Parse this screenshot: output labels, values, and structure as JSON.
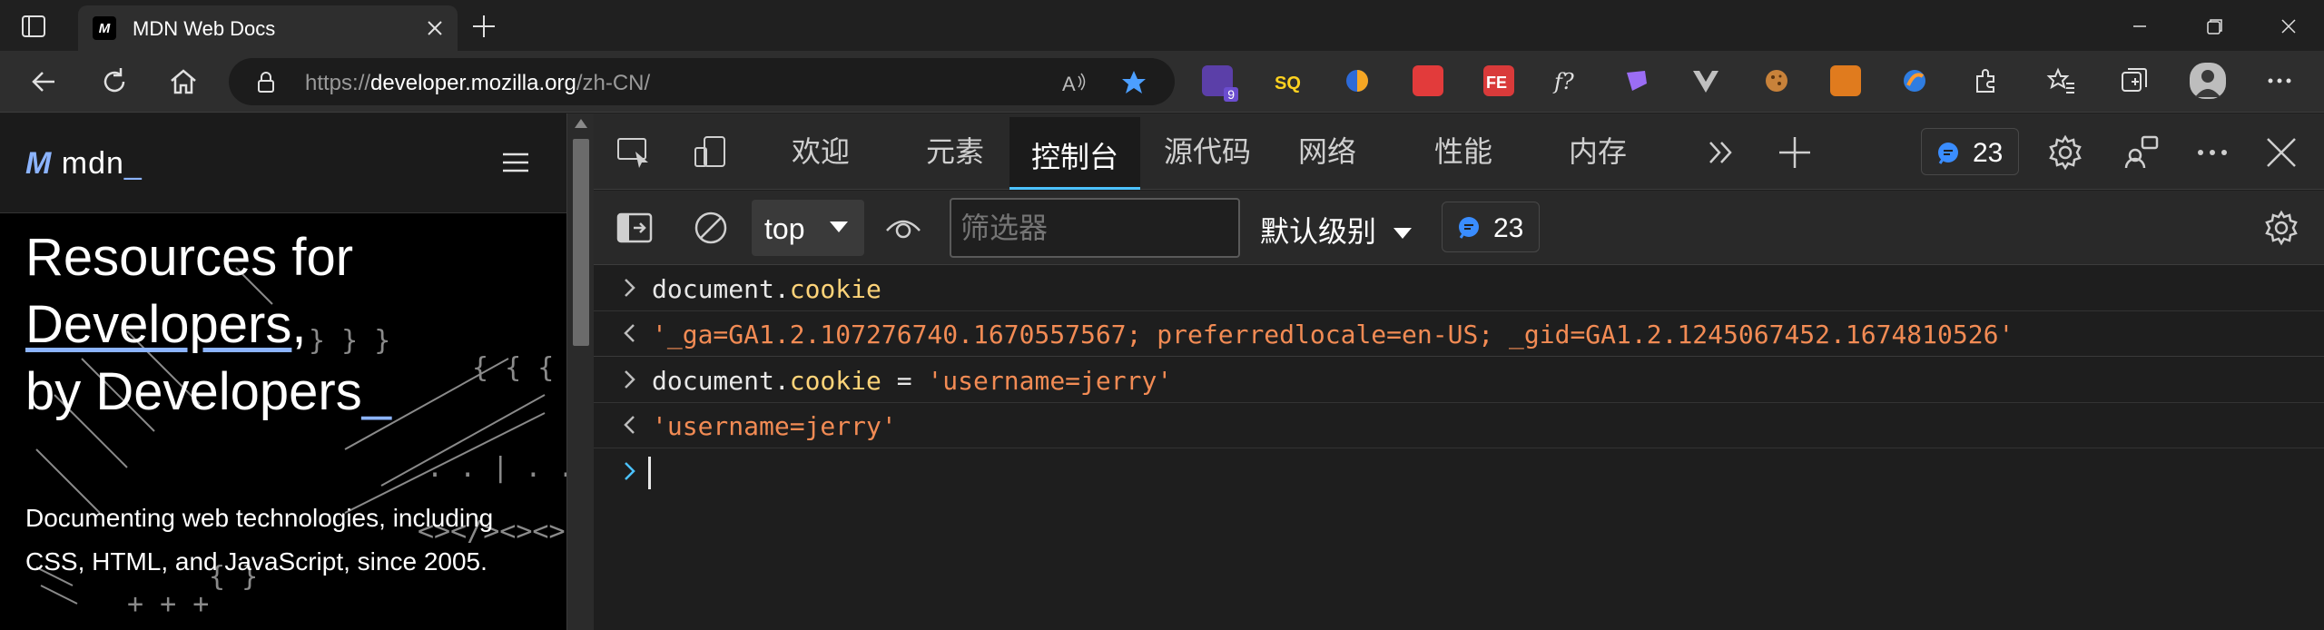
{
  "browser": {
    "tab_title": "MDN Web Docs",
    "tab_favicon_text": "M",
    "url_prefix": "https://",
    "url_host": "developer.mozilla.org",
    "url_path": "/zh-CN/",
    "extension_badge": "9",
    "accent": "#4cc2ff"
  },
  "page": {
    "logo_mark": "M",
    "logo_text": "mdn",
    "logo_cursor": "_",
    "hero_line1": "Resources for",
    "hero_line2": "Developers",
    "hero_line2_tail": ",",
    "hero_line3": "by Developers",
    "hero_cursor": "_",
    "description": "Documenting web technologies, including CSS, HTML, and JavaScript, since 2005."
  },
  "devtools": {
    "tabs": [
      {
        "label": "欢迎"
      },
      {
        "label": "元素"
      },
      {
        "label": "控制台"
      },
      {
        "label": "源代码"
      },
      {
        "label": "网络"
      },
      {
        "label": "性能"
      },
      {
        "label": "内存"
      }
    ],
    "active_tab": "控制台",
    "issues_count": "23",
    "console_toolbar": {
      "context": "top",
      "filter_placeholder": "筛选器",
      "level": "默认级别",
      "messages_count": "23"
    },
    "console_lines": [
      {
        "kind": "input",
        "obj": "document.",
        "prop": "cookie",
        "rest": "",
        "str": ""
      },
      {
        "kind": "output",
        "obj": "",
        "prop": "",
        "rest": "",
        "str": "'_ga=GA1.2.107276740.1670557567; preferredlocale=en-US; _gid=GA1.2.1245067452.1674810526'"
      },
      {
        "kind": "input",
        "obj": "document.",
        "prop": "cookie",
        "rest": " = ",
        "str": "'username=jerry'"
      },
      {
        "kind": "output",
        "obj": "",
        "prop": "",
        "rest": "",
        "str": "'username=jerry'"
      }
    ],
    "colors": {
      "property": "#ffd479",
      "string": "#f28b54",
      "prompt": "#4cc2ff"
    }
  }
}
